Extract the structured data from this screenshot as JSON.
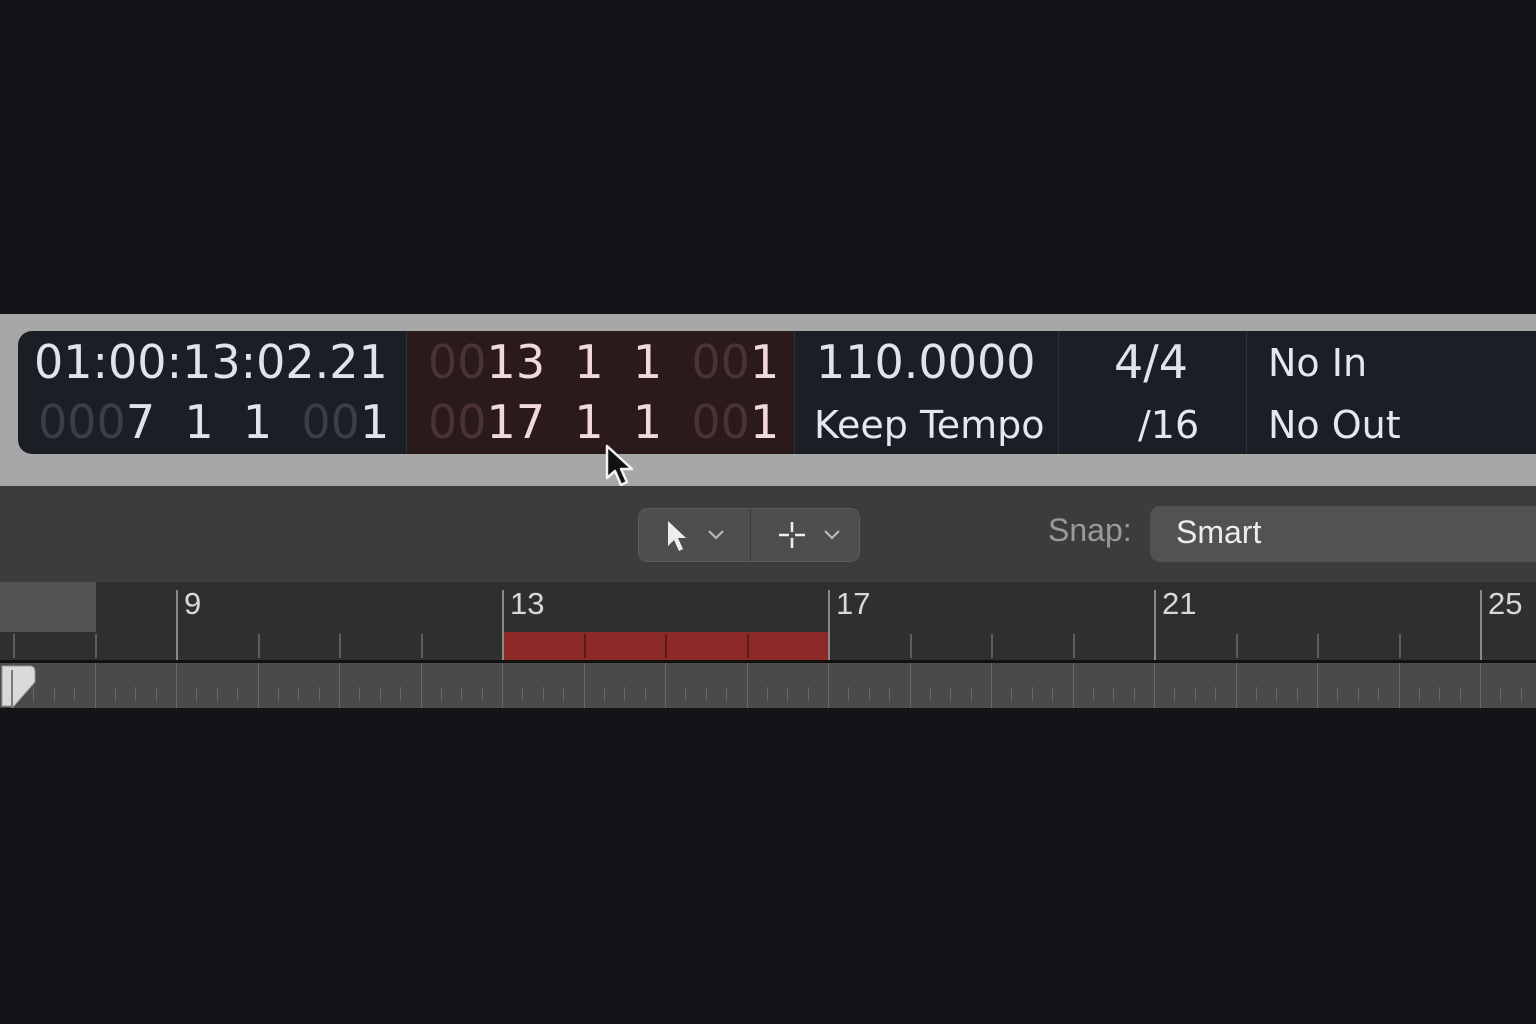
{
  "lcd": {
    "time": {
      "smpte": "01:00:13:02.21",
      "position_dim": "000",
      "position_bar": "7",
      "position_beat": "1",
      "position_div": "1",
      "position_tick_dim": "00",
      "position_tick": "1"
    },
    "cycle": {
      "left_dim": "00",
      "left_bar": "13",
      "left_beat": "1",
      "left_div": "1",
      "left_tick_dim": "00",
      "left_tick": "1",
      "right_dim": "00",
      "right_bar": "17",
      "right_beat": "1",
      "right_div": "1",
      "right_tick_dim": "00",
      "right_tick": "1"
    },
    "tempo": {
      "value": "110.0000",
      "mode": "Keep Tempo"
    },
    "signature": {
      "time_sig": "4/4",
      "division": "/16"
    },
    "in_out": {
      "in": "No In",
      "out": "No Out"
    }
  },
  "toolbar": {
    "left_tool_icon": "pointer-arrow-icon",
    "right_tool_icon": "crosshair-icon",
    "snap_label": "Snap:",
    "snap_value": "Smart"
  },
  "ruler": {
    "bar_labels": [
      "9",
      "13",
      "17",
      "21",
      "25"
    ],
    "cycle_start_bar": 13,
    "cycle_end_bar": 17
  },
  "colors": {
    "cycle_region": "#8d2a28",
    "lcd_background": "#1b1e25",
    "lcd_cycle_background": "#2a1a1c"
  }
}
